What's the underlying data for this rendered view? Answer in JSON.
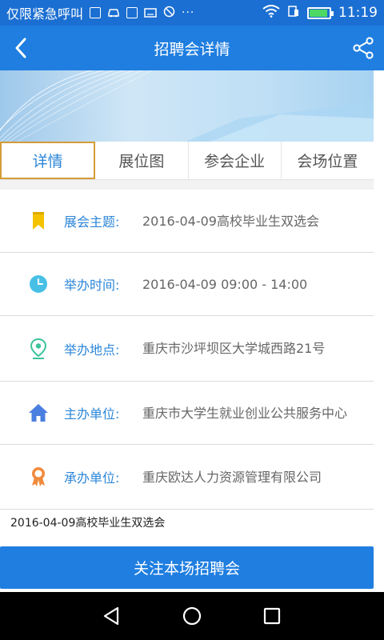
{
  "status_bar": {
    "carrier": "仅限紧急呼叫",
    "dots": "···",
    "time": "11:19",
    "battery_level": 0.9,
    "icons": [
      "sim-icon",
      "car-icon",
      "image-icon",
      "keyboard-icon",
      "blocked-icon",
      "wifi-icon",
      "sim-signal-icon",
      "battery-icon"
    ]
  },
  "header": {
    "title": "招聘会详情",
    "back_icon": "back-arrow-icon",
    "share_icon": "share-icon"
  },
  "tabs": [
    {
      "label": "详情",
      "active": true
    },
    {
      "label": "展位图",
      "active": false
    },
    {
      "label": "参会企业",
      "active": false
    },
    {
      "label": "会场位置",
      "active": false
    }
  ],
  "details": [
    {
      "icon": "bookmark-icon",
      "label": "展会主题:",
      "value": "2016-04-09高校毕业生双选会"
    },
    {
      "icon": "clock-icon",
      "label": "举办时间:",
      "value": "2016-04-09 09:00 - 14:00"
    },
    {
      "icon": "location-pin-icon",
      "label": "举办地点:",
      "value": "重庆市沙坪坝区大学城西路21号"
    },
    {
      "icon": "home-icon",
      "label": "主办单位:",
      "value": "重庆市大学生就业创业公共服务中心"
    },
    {
      "icon": "award-icon",
      "label": "承办单位:",
      "value": "重庆欧达人力资源管理有限公司"
    }
  ],
  "description": "2016-04-09高校毕业生双选会",
  "follow_button": "关注本场招聘会",
  "colors": {
    "primary": "#1f7ee0",
    "label_blue": "#2b86d9",
    "tab_highlight": "#d59b37",
    "bookmark": "#f5c200",
    "clock": "#48c0e6",
    "pin": "#3cc39a",
    "home": "#4a7fe0",
    "award": "#f08a3c"
  }
}
